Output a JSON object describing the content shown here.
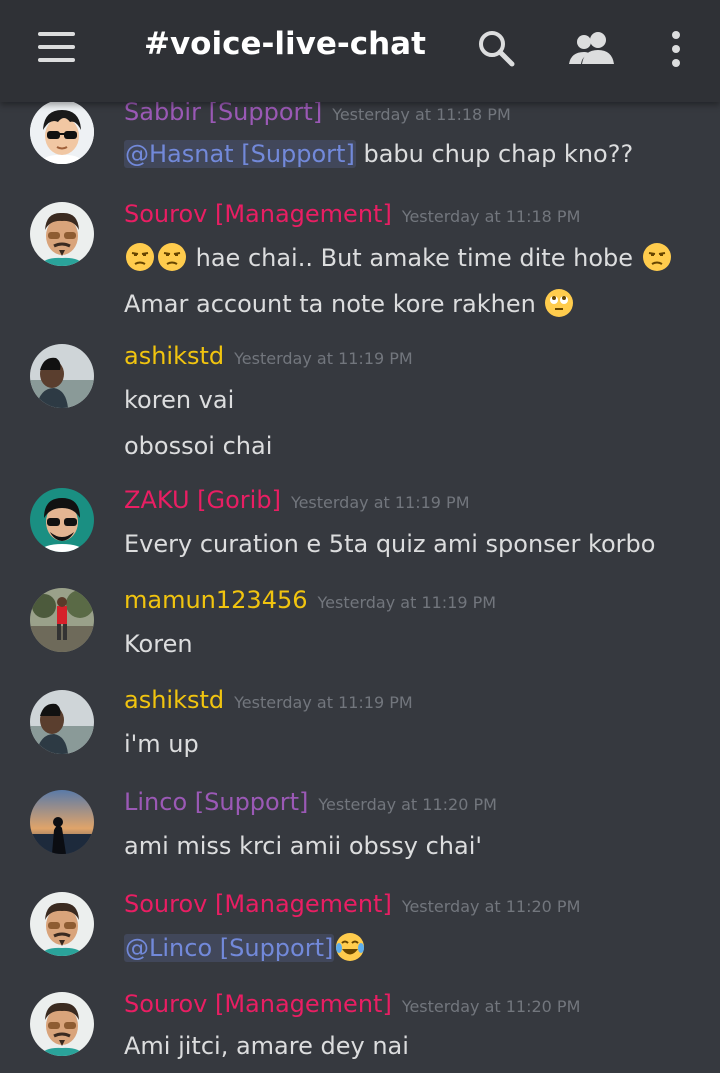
{
  "header": {
    "channel": "#voice-live-chat",
    "icons": [
      "menu-icon",
      "search-icon",
      "members-icon",
      "more-icon"
    ]
  },
  "colors": {
    "support": "#9b59b6",
    "management": "#e91e63",
    "yellow": "#f1c40f",
    "zaku": "#e91e63"
  },
  "messages": [
    {
      "author": "Sabbir [Support]",
      "time": "Yesterday at 11:18 PM",
      "mention": "@Hasnat [Support]",
      "line1": " babu chup chap kno??"
    },
    {
      "author": "Sourov [Management]",
      "time": "Yesterday at 11:18 PM",
      "line1": " hae chai.. But amake time dite hobe ",
      "line2": "Amar account ta note kore rakhen "
    },
    {
      "author": "ashikstd",
      "time": "Yesterday at 11:19 PM",
      "line1": "koren vai",
      "line2": "obossoi chai"
    },
    {
      "author": "ZAKU [Gorib]",
      "time": "Yesterday at 11:19 PM",
      "line1": "Every curation e 5ta quiz ami sponser korbo"
    },
    {
      "author": "mamun123456",
      "time": "Yesterday at 11:19 PM",
      "line1": "Koren"
    },
    {
      "author": "ashikstd",
      "time": "Yesterday at 11:19 PM",
      "line1": "i'm up"
    },
    {
      "author": "Linco [Support]",
      "time": "Yesterday at 11:20 PM",
      "line1": "ami miss krci amii obssy chai'"
    },
    {
      "author": "Sourov [Management]",
      "time": "Yesterday at 11:20 PM",
      "mention": "@Linco [Support]"
    },
    {
      "author": "Sourov [Management]",
      "time": "Yesterday at 11:20 PM",
      "line1": "Ami jitci, amare dey nai"
    }
  ]
}
